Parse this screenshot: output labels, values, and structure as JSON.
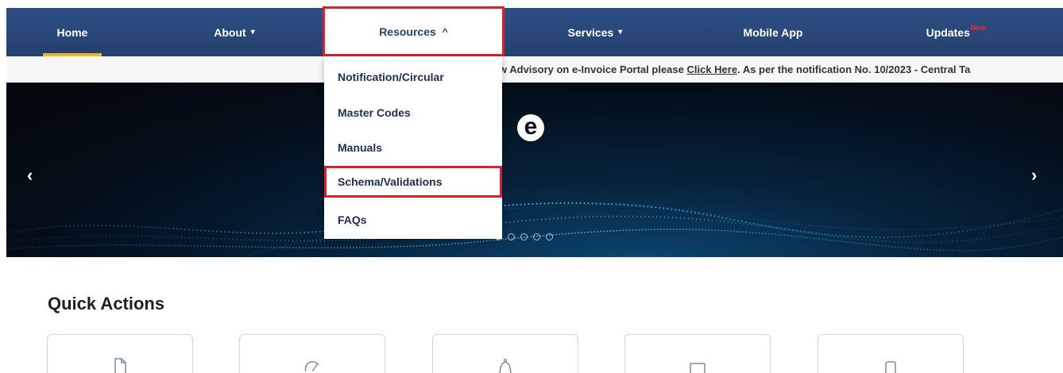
{
  "nav": {
    "items": [
      {
        "label": "Home",
        "chevron": ""
      },
      {
        "label": "About",
        "chevron": "⌄"
      },
      {
        "label": "Resources",
        "chevron": "^"
      },
      {
        "label": "Services",
        "chevron": "⌄"
      },
      {
        "label": "Mobile App",
        "chevron": ""
      },
      {
        "label": "Updates",
        "badge": "New"
      }
    ],
    "active": "Home",
    "open_menu": "Resources"
  },
  "marquee": {
    "text_before": "w Advisory on e-Invoice Portal please ",
    "link": "Click Here",
    "text_after": ". As per the notification No. 10/2023 - Central Ta"
  },
  "banner": {
    "logo_letter": "e",
    "prev_arrow": "‹",
    "next_arrow": "›",
    "slides": 5,
    "active_slide": 1
  },
  "dropdown": {
    "items": [
      {
        "label": "Notification/Circular"
      },
      {
        "label": "Master Codes"
      },
      {
        "label": "Manuals"
      },
      {
        "label": "Schema/Validations",
        "highlighted": true
      },
      {
        "label": "FAQs"
      }
    ]
  },
  "quick_actions": {
    "title": "Quick Actions",
    "cards": [
      {
        "icon": "document-icon"
      },
      {
        "icon": "gauge-icon"
      },
      {
        "icon": "bell-icon"
      },
      {
        "icon": "monitor-icon"
      },
      {
        "icon": "mobile-icon"
      }
    ]
  },
  "colors": {
    "nav_bg": "#2f4f85",
    "highlight_border": "#d8212a",
    "home_underline": "#f0b429",
    "new_badge": "#ff2a2a"
  }
}
